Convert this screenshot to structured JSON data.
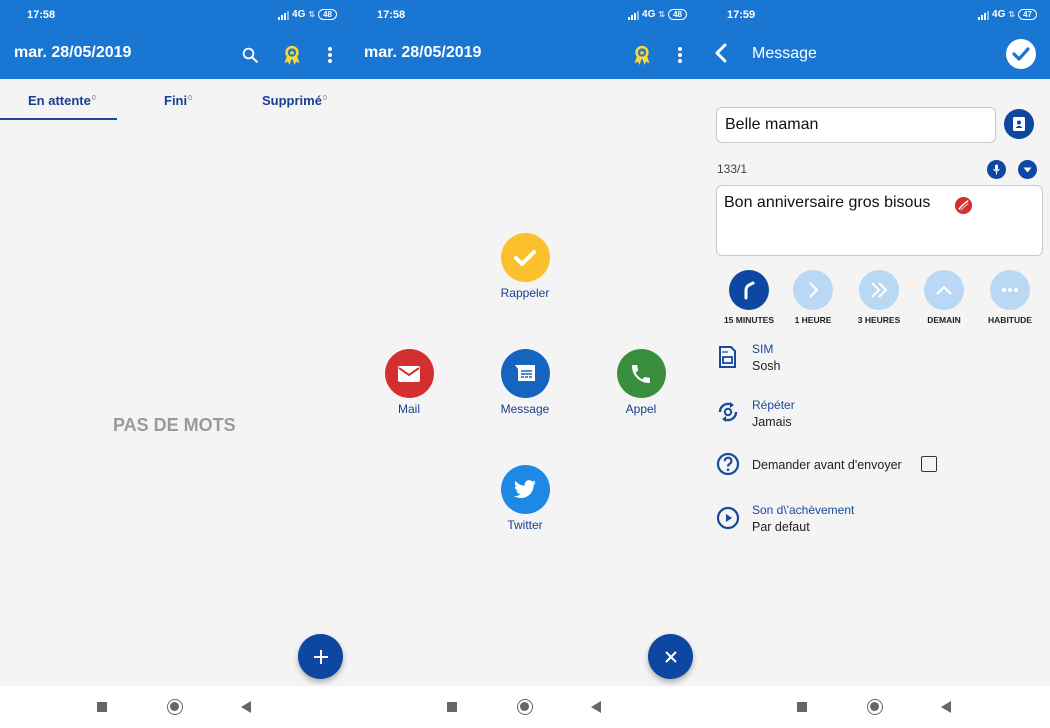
{
  "colors": {
    "primary": "#1976d2",
    "primary_dark": "#0d47a1",
    "tab_text": "#1a3f8f",
    "rappeler": "#fbc02d",
    "mail": "#d32f2f",
    "message": "#1565c0",
    "appel": "#388e3c",
    "twitter": "#1e88e5",
    "delay_inactive": "#b9d8f3"
  },
  "screens": [
    {
      "status": {
        "time": "17:58",
        "network": "4G",
        "battery": "48"
      },
      "appbar": {
        "title": "mar. 28/05/2019",
        "icons": [
          "search-icon",
          "award-badge-icon",
          "more-vert-icon"
        ]
      },
      "tabs": [
        {
          "label": "En attente",
          "count": "0",
          "active": true
        },
        {
          "label": "Fini",
          "count": "0",
          "active": false
        },
        {
          "label": "Supprimé",
          "count": "0",
          "active": false
        }
      ],
      "empty_state": "PAS DE MOTS",
      "fab": {
        "icon": "plus-icon",
        "label": "+"
      }
    },
    {
      "status": {
        "time": "17:58",
        "network": "4G",
        "battery": "48"
      },
      "appbar": {
        "title": "mar. 28/05/2019",
        "icons": [
          "award-badge-icon",
          "more-vert-icon"
        ]
      },
      "actions": [
        {
          "label": "Rappeler",
          "icon": "check-icon"
        },
        {
          "label": "Mail",
          "icon": "mail-icon"
        },
        {
          "label": "Message",
          "icon": "message-icon"
        },
        {
          "label": "Appel",
          "icon": "phone-icon"
        },
        {
          "label": "Twitter",
          "icon": "twitter-icon"
        }
      ],
      "fab": {
        "icon": "close-icon",
        "label": "×"
      }
    },
    {
      "status": {
        "time": "17:59",
        "network": "4G",
        "battery": "47"
      },
      "appbar": {
        "title": "Message"
      },
      "contact": {
        "value": "Belle maman"
      },
      "counter": "133/1",
      "message": {
        "value": "Bon anniversaire gros bisous",
        "emoji": "kiss-mark"
      },
      "delays": [
        {
          "label": "15 MINUTES",
          "icon": "clock-quarter-icon",
          "active": true
        },
        {
          "label": "1 HEURE",
          "icon": "chevron-right-icon",
          "active": false
        },
        {
          "label": "3 HEURES",
          "icon": "double-chevron-right-icon",
          "active": false
        },
        {
          "label": "DEMAIN",
          "icon": "chevron-up-icon",
          "active": false
        },
        {
          "label": "HABITUDE",
          "icon": "more-horiz-icon",
          "active": false
        }
      ],
      "options": [
        {
          "title": "SIM",
          "value": "Sosh",
          "icon": "sim-card-icon"
        },
        {
          "title": "Répéter",
          "value": "Jamais",
          "icon": "repeat-icon"
        },
        {
          "title": "Demander avant d'envoyer",
          "checked": false,
          "icon": "help-circle-icon"
        },
        {
          "title": "Son d\\'achèvement",
          "value": "Par defaut",
          "icon": "play-circle-icon"
        }
      ]
    }
  ],
  "navbar": {
    "buttons": [
      "recents",
      "home",
      "back"
    ]
  }
}
